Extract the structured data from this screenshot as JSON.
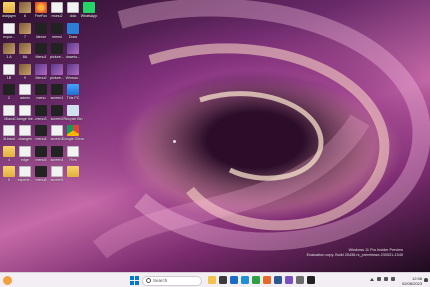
{
  "desktop": {
    "icons": [
      {
        "label": "dsbjaym",
        "glyph": "folder"
      },
      {
        "label": "6",
        "glyph": "img"
      },
      {
        "label": "FireFox",
        "glyph": "ff"
      },
      {
        "label": "monu2",
        "glyph": "doc"
      },
      {
        "label": "dolo",
        "glyph": "doc"
      },
      {
        "label": "WhatsApp",
        "glyph": "whatsapp"
      },
      {
        "label": "expor...",
        "glyph": "doc"
      },
      {
        "label": "7",
        "glyph": "img"
      },
      {
        "label": "Ideoor",
        "glyph": "dark"
      },
      {
        "label": "menul",
        "glyph": "dark"
      },
      {
        "label": "Docs",
        "glyph": "blue"
      },
      {
        "label": "",
        "glyph": ""
      },
      {
        "label": "1 A",
        "glyph": "img"
      },
      {
        "label": "8A",
        "glyph": "img"
      },
      {
        "label": "Menu1",
        "glyph": "dark"
      },
      {
        "label": "picture...",
        "glyph": "dark"
      },
      {
        "label": "downlo...",
        "glyph": "purple"
      },
      {
        "label": "",
        "glyph": ""
      },
      {
        "label": "1B",
        "glyph": "doc"
      },
      {
        "label": "9",
        "glyph": "img"
      },
      {
        "label": "Menu2",
        "glyph": "purple"
      },
      {
        "label": "picture...",
        "glyph": "purple"
      },
      {
        "label": "Winrow...",
        "glyph": "purple"
      },
      {
        "label": "",
        "glyph": ""
      },
      {
        "label": "2",
        "glyph": "dark"
      },
      {
        "label": "admin",
        "glyph": "doc"
      },
      {
        "label": "menu",
        "glyph": "dark"
      },
      {
        "label": "screen1",
        "glyph": "dark"
      },
      {
        "label": "This PC",
        "glyph": "pc"
      },
      {
        "label": "",
        "glyph": ""
      },
      {
        "label": "3Kand",
        "glyph": "doc"
      },
      {
        "label": "Change the...",
        "glyph": "doc"
      },
      {
        "label": "menu3",
        "glyph": "dark"
      },
      {
        "label": "screen2",
        "glyph": "dark"
      },
      {
        "label": "Recycle Bin",
        "glyph": "recycle"
      },
      {
        "label": "",
        "glyph": ""
      },
      {
        "label": "3Lband",
        "glyph": "doc"
      },
      {
        "label": "changes",
        "glyph": "doc"
      },
      {
        "label": "menu4",
        "glyph": "dark"
      },
      {
        "label": "screen3",
        "glyph": "doc"
      },
      {
        "label": "Google Chrome",
        "glyph": "chrome"
      },
      {
        "label": "",
        "glyph": ""
      },
      {
        "label": "4",
        "glyph": "folder"
      },
      {
        "label": "edge",
        "glyph": "doc"
      },
      {
        "label": "menu5",
        "glyph": "dark"
      },
      {
        "label": "screen4",
        "glyph": "dark"
      },
      {
        "label": "Files",
        "glyph": "doc"
      },
      {
        "label": "",
        "glyph": ""
      },
      {
        "label": "5",
        "glyph": "folder"
      },
      {
        "label": "experie...",
        "glyph": "doc"
      },
      {
        "label": "menu6",
        "glyph": "dark"
      },
      {
        "label": "screen5",
        "glyph": "doc"
      },
      {
        "label": "",
        "glyph": "folder"
      },
      {
        "label": "",
        "glyph": ""
      }
    ]
  },
  "watermark": {
    "line1": "Windows 11 Pro Insider Preview",
    "line2": "Evaluation copy. Build 25436.rs_prerelease.230531-1545"
  },
  "taskbar": {
    "search_placeholder": "Search",
    "apps": [
      "file-explorer",
      "store",
      "mail",
      "edge",
      "chrome",
      "firefox",
      "word",
      "photos",
      "settings",
      "terminal"
    ],
    "time": "12:58",
    "date": "02/08/2023"
  }
}
